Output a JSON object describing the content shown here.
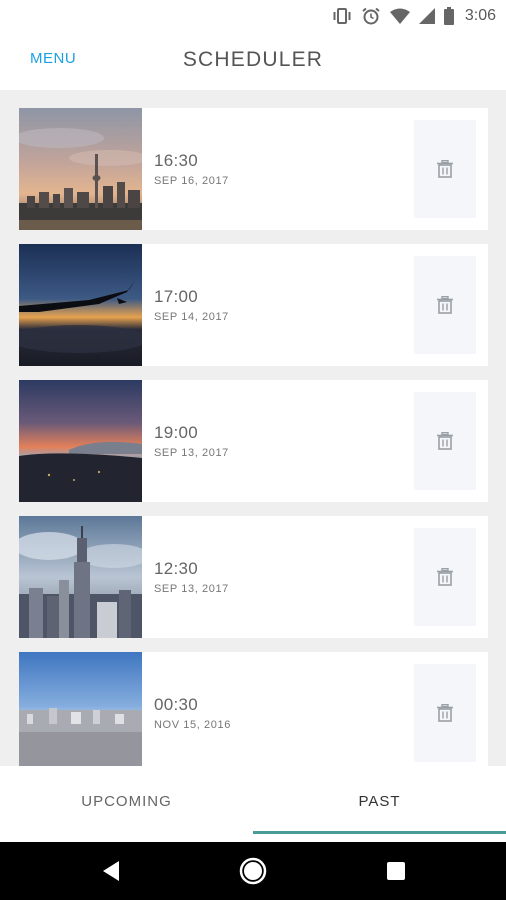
{
  "status_bar": {
    "time": "3:06",
    "icons": [
      "vibrate-icon",
      "alarm-icon",
      "wifi-icon",
      "cellular-icon",
      "battery-icon"
    ]
  },
  "header": {
    "menu_label": "MENU",
    "title": "SCHEDULER"
  },
  "schedule": {
    "items": [
      {
        "time": "16:30",
        "date": "SEP 16, 2017",
        "thumbnail": "city-skyline-tower"
      },
      {
        "time": "17:00",
        "date": "SEP 14, 2017",
        "thumbnail": "airplane-wing-sunset"
      },
      {
        "time": "19:00",
        "date": "SEP 13, 2017",
        "thumbnail": "sunset-coast"
      },
      {
        "time": "12:30",
        "date": "SEP 13, 2017",
        "thumbnail": "empire-state-building"
      },
      {
        "time": "00:30",
        "date": "NOV 15, 2016",
        "thumbnail": "city-panorama"
      }
    ]
  },
  "tabs": {
    "upcoming_label": "UPCOMING",
    "past_label": "PAST",
    "active": "past"
  },
  "colors": {
    "accent": "#1ba1e2",
    "tab_indicator": "#4a9a98",
    "list_background": "#efefef"
  }
}
